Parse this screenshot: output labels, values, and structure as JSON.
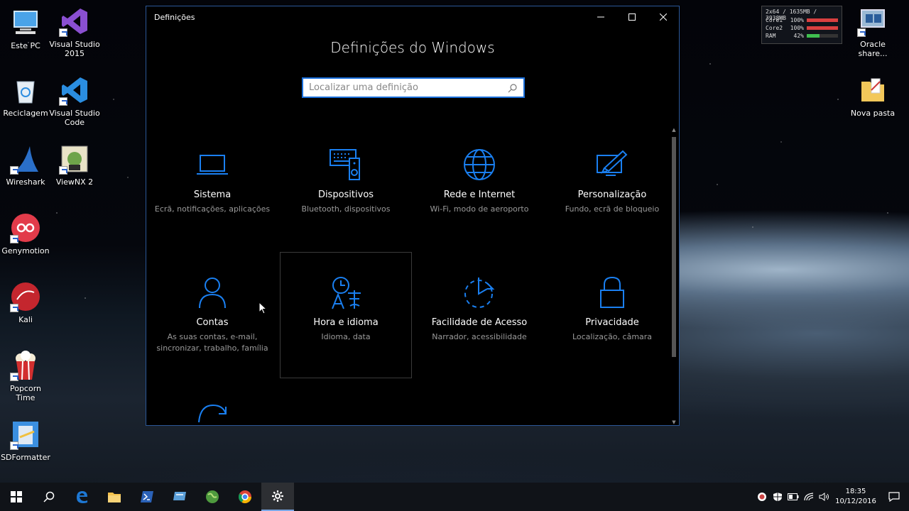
{
  "desktop": {
    "left_icons": [
      {
        "label": "Este PC",
        "icon": "computer-icon"
      },
      {
        "label": "Visual Studio 2015",
        "icon": "visual-studio-icon"
      },
      {
        "label": "Reciclagem",
        "icon": "recycle-bin-icon"
      },
      {
        "label": "Visual Studio Code",
        "icon": "vscode-icon"
      },
      {
        "label": "Wireshark",
        "icon": "wireshark-icon"
      },
      {
        "label": "ViewNX 2",
        "icon": "viewnx-icon"
      },
      {
        "label": "Genymotion",
        "icon": "genymotion-icon"
      },
      {
        "label": "Kali",
        "icon": "kali-icon"
      },
      {
        "label": "Popcorn Time",
        "icon": "popcorn-icon"
      },
      {
        "label": "SDFormatter",
        "icon": "sdformatter-icon"
      }
    ],
    "right_icons": [
      {
        "label": "Oracle share...",
        "icon": "virtualbox-icon"
      },
      {
        "label": "Nova pasta",
        "icon": "folder-icon"
      }
    ]
  },
  "perf_widget": {
    "header": "2x64 / 1635MB / 3938MB",
    "rows": [
      {
        "label": "Core1",
        "value": "100%",
        "level": 1.0,
        "color": "#d94040"
      },
      {
        "label": "Core2",
        "value": "100%",
        "level": 1.0,
        "color": "#d94040"
      },
      {
        "label": "RAM",
        "value": "42%",
        "level": 0.42,
        "color": "#3fbf4f"
      }
    ]
  },
  "window": {
    "title": "Definições",
    "page_title": "Definições do Windows",
    "search_placeholder": "Localizar uma definição",
    "tiles": [
      {
        "name": "Sistema",
        "desc": "Ecrã, notificações, aplicações",
        "icon": "laptop-icon"
      },
      {
        "name": "Dispositivos",
        "desc": "Bluetooth, dispositivos",
        "icon": "devices-icon"
      },
      {
        "name": "Rede e Internet",
        "desc": "Wi-Fi, modo de aeroporto",
        "icon": "globe-icon"
      },
      {
        "name": "Personalização",
        "desc": "Fundo, ecrã de bloqueio",
        "icon": "paint-icon"
      },
      {
        "name": "Contas",
        "desc": "As suas contas, e-mail, sincronizar, trabalho, família",
        "icon": "person-icon"
      },
      {
        "name": "Hora e idioma",
        "desc": "Idioma, data",
        "icon": "time-language-icon"
      },
      {
        "name": "Facilidade de Acesso",
        "desc": "Narrador, acessibilidade",
        "icon": "ease-access-icon"
      },
      {
        "name": "Privacidade",
        "desc": "Localização, câmara",
        "icon": "lock-icon"
      }
    ],
    "accent": "#1a7ff0"
  },
  "taskbar": {
    "clock_time": "18:35",
    "clock_date": "10/12/2016"
  }
}
